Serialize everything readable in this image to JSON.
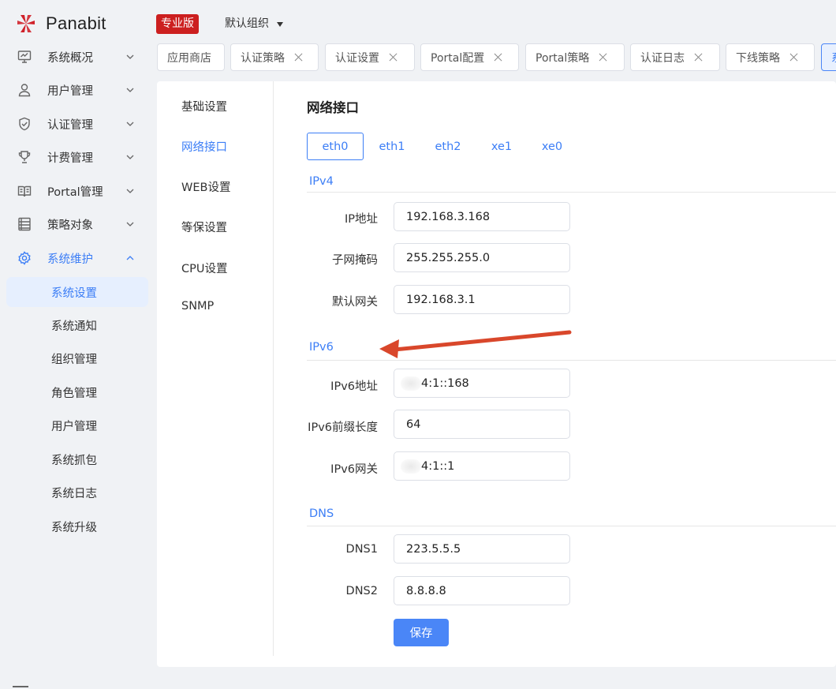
{
  "brand": {
    "name": "Panabit",
    "edition": "专业版",
    "logo_color": "#d0212a"
  },
  "org_selector": {
    "value": "默认组织"
  },
  "tabs": [
    {
      "label": "应用商店",
      "closable": false
    },
    {
      "label": "认证策略",
      "closable": true
    },
    {
      "label": "认证设置",
      "closable": true
    },
    {
      "label": "Portal配置",
      "closable": true
    },
    {
      "label": "Portal策略",
      "closable": true
    },
    {
      "label": "认证日志",
      "closable": true
    },
    {
      "label": "下线策略",
      "closable": true
    },
    {
      "label": "系",
      "closable": false,
      "active": true
    }
  ],
  "sidebar": {
    "items": [
      {
        "label": "系统概况",
        "icon": "monitor-icon"
      },
      {
        "label": "用户管理",
        "icon": "user-icon"
      },
      {
        "label": "认证管理",
        "icon": "shield-icon"
      },
      {
        "label": "计费管理",
        "icon": "trophy-icon"
      },
      {
        "label": "Portal管理",
        "icon": "book-icon"
      },
      {
        "label": "策略对象",
        "icon": "list-icon"
      },
      {
        "label": "系统维护",
        "icon": "gear-icon",
        "open": true
      }
    ],
    "subitems": [
      "系统设置",
      "系统通知",
      "组织管理",
      "角色管理",
      "用户管理",
      "系统抓包",
      "系统日志",
      "系统升级"
    ],
    "active_subitem": "系统设置"
  },
  "settings_nav": {
    "items": [
      "基础设置",
      "网络接口",
      "WEB设置",
      "等保设置",
      "CPU设置",
      "SNMP"
    ],
    "active": "网络接口"
  },
  "section_title": "网络接口",
  "interfaces": {
    "items": [
      "eth0",
      "eth1",
      "eth2",
      "xe1",
      "xe0"
    ],
    "active": "eth0"
  },
  "ipv4": {
    "title": "IPv4",
    "ip_label": "IP地址",
    "ip_value": "192.168.3.168",
    "mask_label": "子网掩码",
    "mask_value": "255.255.255.0",
    "gateway_label": "默认网关",
    "gateway_value": "192.168.3.1"
  },
  "ipv6": {
    "title": "IPv6",
    "ip_label": "IPv6地址",
    "ip_value": "4:1::168",
    "prefix_label": "IPv6前缀长度",
    "prefix_value": "64",
    "gateway_label": "IPv6网关",
    "gateway_value": "4:1::1"
  },
  "dns": {
    "title": "DNS",
    "dns1_label": "DNS1",
    "dns1_value": "223.5.5.5",
    "dns2_label": "DNS2",
    "dns2_value": "8.8.8.8"
  },
  "save_label": "保存",
  "colors": {
    "accent": "#3c7ef6",
    "badge": "#cc1f1f",
    "arrow": "#d9472b"
  }
}
